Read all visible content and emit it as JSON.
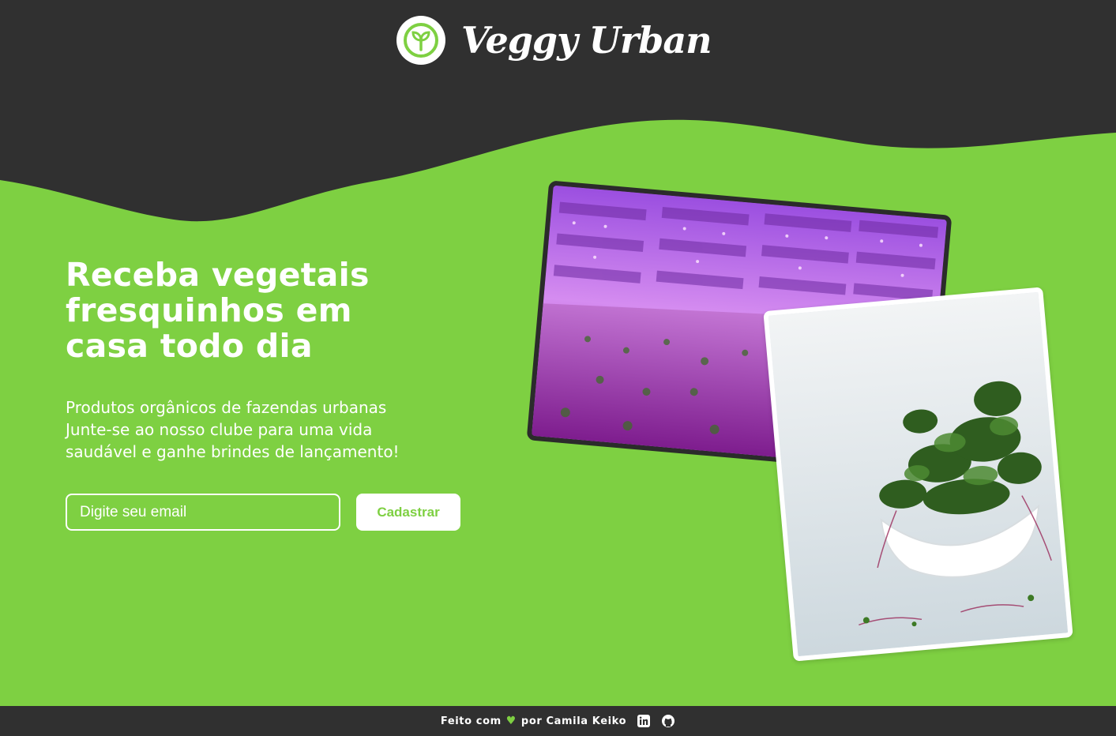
{
  "brand": {
    "name": "Veggy Urban",
    "logo_icon": "sprout-icon"
  },
  "hero": {
    "title": "Receba vegetais fresquinhos em casa todo dia",
    "description_lines": [
      "Produtos orgânicos de fazendas urbanas",
      "Junte-se ao nosso clube para uma vida",
      "saudável e ganhe brindes de lançamento!"
    ]
  },
  "signup": {
    "email_placeholder": "Digite seu email",
    "button_label": "Cadastrar"
  },
  "images": {
    "farm_icon": "vertical-farm-photo",
    "greens_icon": "microgreens-bowl-photo"
  },
  "footer": {
    "made_with": "Feito com",
    "heart": "♥",
    "by": "por Camila Keiko",
    "linkedin_icon": "linkedin-icon",
    "github_icon": "github-icon"
  },
  "colors": {
    "primary_green": "#7ED042",
    "dark": "#303030",
    "white": "#FFFFFF"
  }
}
